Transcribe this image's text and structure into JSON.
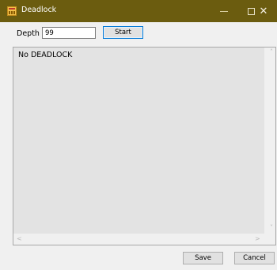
{
  "window": {
    "title": "Deadlock",
    "icon": "app-icon",
    "controls": {
      "minimize_icon": "minimize-icon",
      "maximize_icon": "maximize-icon",
      "close_glyph": "✕"
    }
  },
  "toolbar": {
    "depth_label": "Depth",
    "depth_value": "99",
    "start_label": "Start"
  },
  "output": {
    "text": "No DEADLOCK",
    "scroll_up": "˄",
    "scroll_down": "˅",
    "scroll_left": "<",
    "scroll_right": ">"
  },
  "footer": {
    "save_label": "Save",
    "cancel_label": "Cancel"
  },
  "colors": {
    "titlebar": "#6b5c0f",
    "window_bg": "#f0f0f0",
    "output_bg": "#e3e3e3",
    "accent_border": "#0078d7"
  }
}
